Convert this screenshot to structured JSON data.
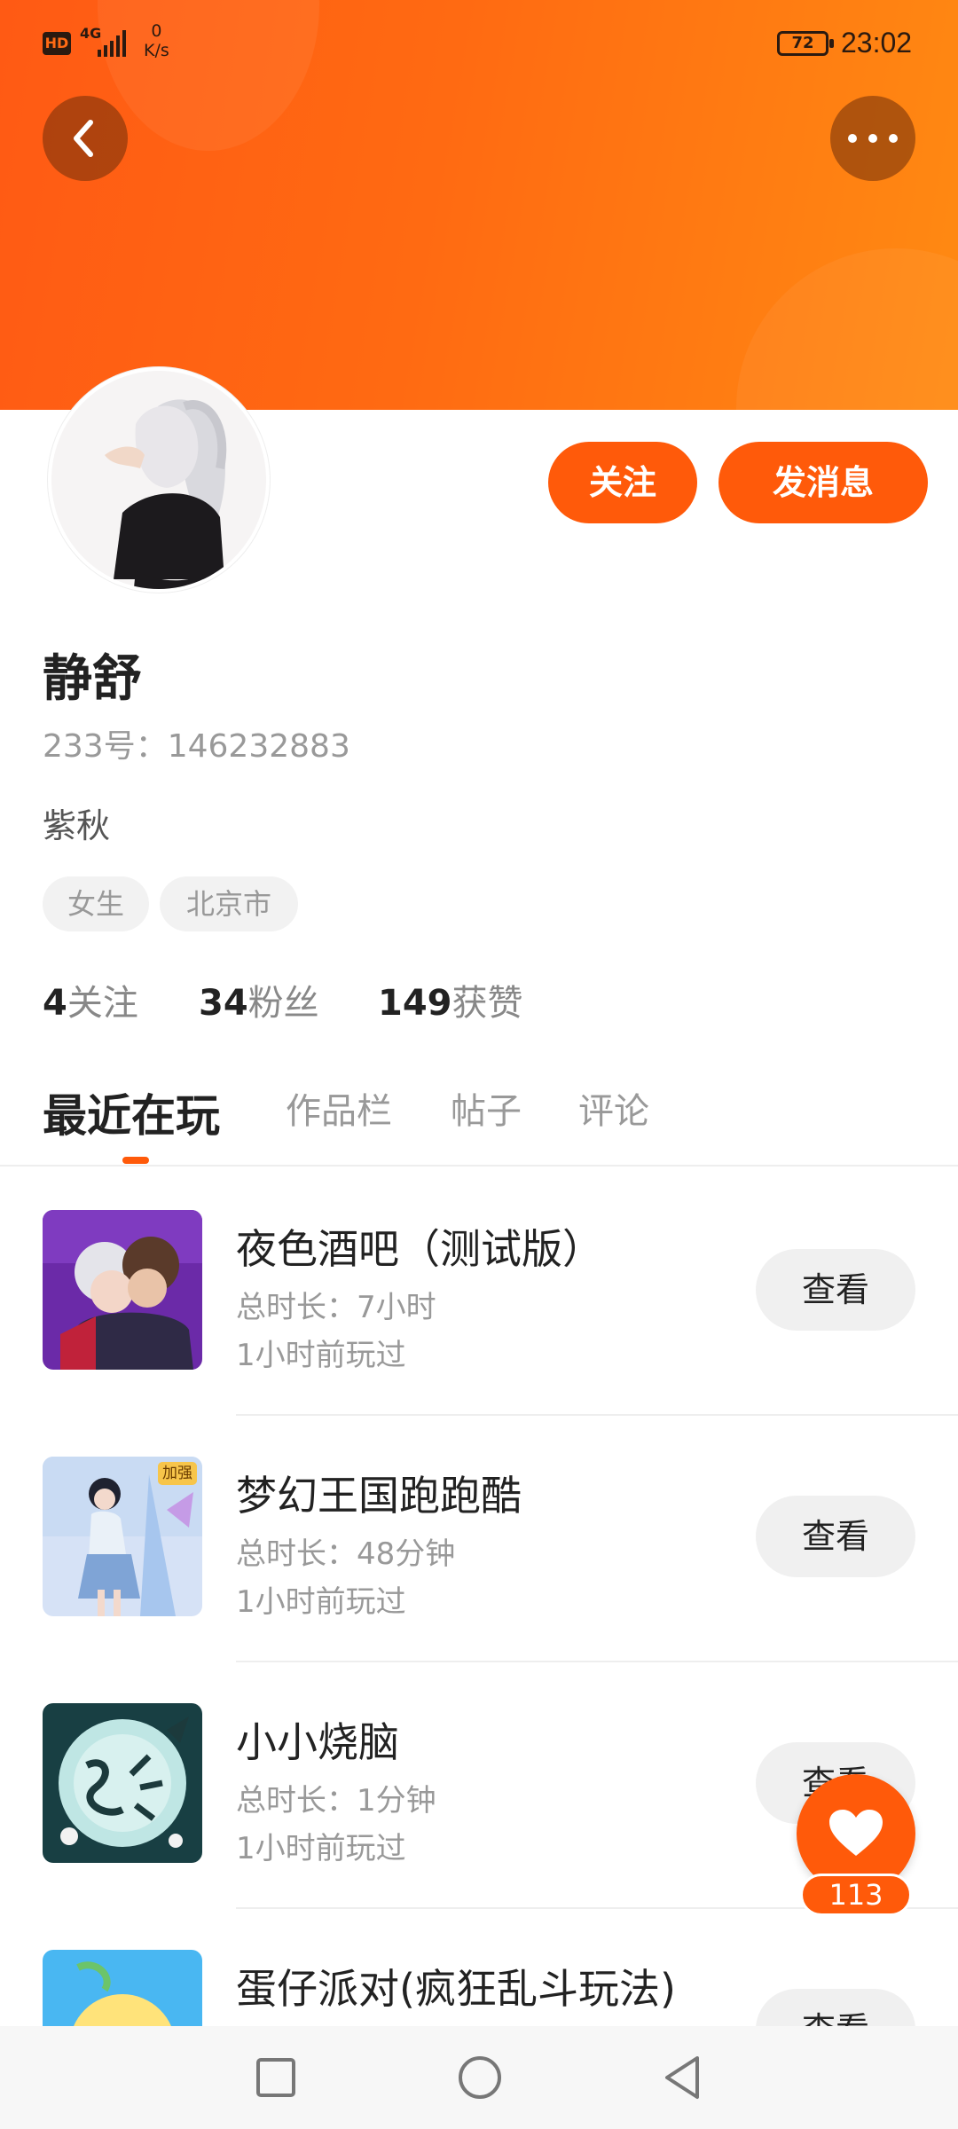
{
  "status_bar": {
    "hd": "HD",
    "network": "4G",
    "speed_value": "0",
    "speed_unit": "K/s",
    "battery": "72",
    "time": "23:02"
  },
  "profile": {
    "name": "静舒",
    "uid": "233号：146232883",
    "bio": "紫秋",
    "tags": [
      "女生",
      "北京市"
    ],
    "stats": {
      "following_count": "4",
      "following_label": "关注",
      "fans_count": "34",
      "fans_label": "粉丝",
      "likes_count": "149",
      "likes_label": "获赞"
    }
  },
  "actions": {
    "follow_label": "关注",
    "message_label": "发消息"
  },
  "tabs": [
    "最近在玩",
    "作品栏",
    "帖子",
    "评论"
  ],
  "games": [
    {
      "title": "夜色酒吧（测试版）",
      "duration": "总时长：7小时",
      "last_played": "1小时前玩过",
      "button": "查看"
    },
    {
      "title": "梦幻王国跑跑酷",
      "duration": "总时长：48分钟",
      "last_played": "1小时前玩过",
      "button": "查看",
      "badge": "加强"
    },
    {
      "title": "小小烧脑",
      "duration": "总时长：1分钟",
      "last_played": "1小时前玩过",
      "button": "查看"
    },
    {
      "title": "蛋仔派对(疯狂乱斗玩法)",
      "duration": "",
      "last_played": "",
      "button": "查看"
    }
  ],
  "like_fab": {
    "count": "113"
  },
  "colors": {
    "accent": "#ff5a0a",
    "header_gradient_start": "#ff5a14",
    "header_gradient_end": "#ff8a12"
  },
  "icons": [
    "back-arrow-icon",
    "more-dots-icon",
    "heart-icon",
    "recent-apps-icon",
    "home-icon",
    "back-triangle-icon"
  ]
}
